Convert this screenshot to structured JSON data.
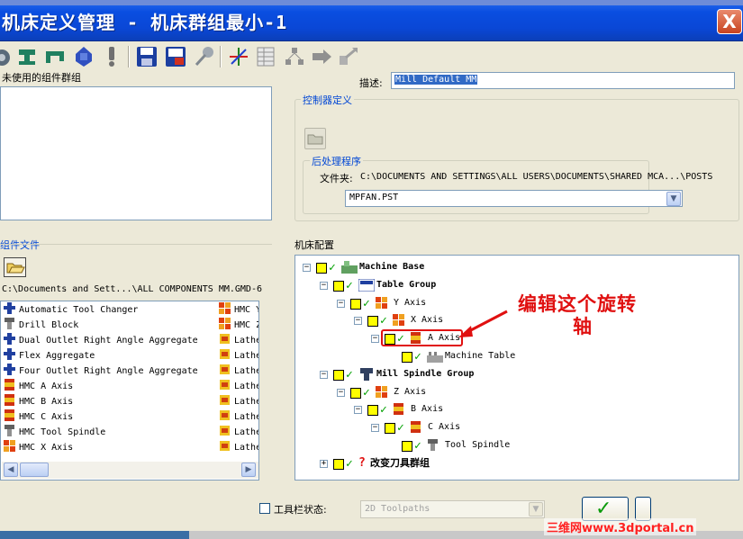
{
  "window": {
    "title": "机床定义管理 - 机床群组最小-1",
    "close_glyph": "X"
  },
  "toolbar": {
    "icons": [
      "axis-icon",
      "spindle-icon",
      "clamp-icon",
      "motor-icon",
      "warning-icon",
      "save-icon",
      "save-as-icon",
      "pin-icon",
      "axes-icon",
      "table-icon",
      "tree-icon",
      "arrow-right-icon",
      "move-icon"
    ]
  },
  "unused_groups": {
    "label": "未使用的组件群组"
  },
  "description": {
    "label": "描述:",
    "value": "Mill Default MM"
  },
  "controller": {
    "label": "控制器定义"
  },
  "post": {
    "label": "后处理程序",
    "folder_label": "文件夹:",
    "folder_path": "C:\\DOCUMENTS AND SETTINGS\\ALL USERS\\DOCUMENTS\\SHARED MCA...\\POSTS",
    "selected": "MPFAN.PST"
  },
  "component_file": {
    "label": "组件文件",
    "path": "C:\\Documents and Sett...\\ALL COMPONENTS MM.GMD-6",
    "col1": [
      {
        "label": "Automatic Tool Changer",
        "icon": "tool-changer-icon"
      },
      {
        "label": "Drill Block",
        "icon": "drill-block-icon"
      },
      {
        "label": "Dual Outlet Right Angle Aggregate",
        "icon": "aggregate-icon"
      },
      {
        "label": "Flex Aggregate",
        "icon": "aggregate-icon"
      },
      {
        "label": "Four Outlet Right Angle Aggregate",
        "icon": "aggregate-icon"
      },
      {
        "label": "HMC A Axis",
        "icon": "rotary-axis-icon"
      },
      {
        "label": "HMC B Axis",
        "icon": "rotary-axis-icon"
      },
      {
        "label": "HMC C Axis",
        "icon": "rotary-axis-icon"
      },
      {
        "label": "HMC Tool Spindle",
        "icon": "spindle-icon"
      },
      {
        "label": "HMC X Axis",
        "icon": "linear-axis-icon"
      }
    ],
    "col2": [
      {
        "label": "HMC Y",
        "icon": "linear-axis-icon"
      },
      {
        "label": "HMC Z",
        "icon": "linear-axis-icon"
      },
      {
        "label": "Lathe",
        "icon": "lathe-icon"
      },
      {
        "label": "Lathe",
        "icon": "lathe-icon"
      },
      {
        "label": "Lathe",
        "icon": "lathe-icon"
      },
      {
        "label": "Lathe",
        "icon": "lathe-icon"
      },
      {
        "label": "Lathe",
        "icon": "lathe-icon"
      },
      {
        "label": "Lathe",
        "icon": "lathe-icon"
      },
      {
        "label": "Lathe",
        "icon": "lathe-icon"
      },
      {
        "label": "Lathe",
        "icon": "lathe-icon"
      }
    ]
  },
  "machine_config": {
    "label": "机床配置",
    "tree": [
      {
        "label": "Machine Base",
        "bold": true,
        "icon": "base-icon"
      },
      {
        "label": "Table Group",
        "bold": true,
        "icon": "table-group-icon"
      },
      {
        "label": "Y Axis",
        "bold": false,
        "icon": "linear-axis-icon"
      },
      {
        "label": "X Axis",
        "bold": false,
        "icon": "linear-axis-icon"
      },
      {
        "label": "A Axis",
        "bold": false,
        "icon": "rotary-axis-icon"
      },
      {
        "label": "Machine Table",
        "bold": false,
        "icon": "machine-table-icon"
      },
      {
        "label": "Mill Spindle Group",
        "bold": true,
        "icon": "spindle-group-icon"
      },
      {
        "label": "Z Axis",
        "bold": false,
        "icon": "linear-axis-icon"
      },
      {
        "label": "B Axis",
        "bold": false,
        "icon": "rotary-axis-icon"
      },
      {
        "label": "C Axis",
        "bold": false,
        "icon": "rotary-axis-icon"
      },
      {
        "label": "Tool Spindle",
        "bold": false,
        "icon": "spindle-icon"
      },
      {
        "label": "改变刀具群组",
        "bold": true,
        "icon": "question-icon"
      }
    ]
  },
  "annotation": {
    "line1": "编辑这个旋转",
    "line2": "轴"
  },
  "footer": {
    "toolbar_state_label": "工具栏状态:",
    "toolbar_state_value": "2D Toolpaths",
    "ok_glyph": "✓"
  },
  "watermark": {
    "text": "三维网www.3dportal.cn"
  },
  "colors": {
    "titlebar": "#0a47d6",
    "panel": "#ece9d8",
    "annotation": "#e01010",
    "group_label": "#0046d5"
  }
}
